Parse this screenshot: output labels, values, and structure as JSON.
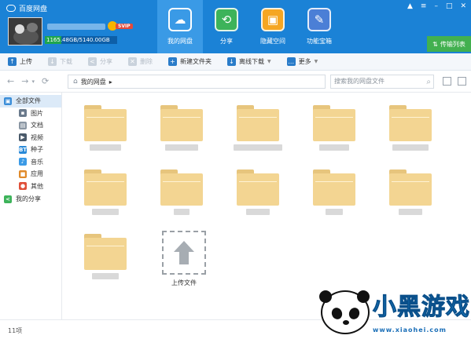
{
  "app": {
    "title": "百度网盘"
  },
  "user": {
    "badge": "SVIP",
    "quota": "1165.48GB/5140.00GB",
    "quota_fraction": 0.227
  },
  "main_tabs": [
    {
      "label": "我的网盘",
      "icon": "cloud-icon",
      "color": "#3a9ae6",
      "active": true
    },
    {
      "label": "分享",
      "icon": "share-icon",
      "color": "#3db35a",
      "active": false
    },
    {
      "label": "隐藏空间",
      "icon": "lock-icon",
      "color": "#f5a623",
      "active": false
    },
    {
      "label": "功能宝箱",
      "icon": "tools-icon",
      "color": "#4b7fd6",
      "active": false
    }
  ],
  "window_controls": [
    "▲",
    "≡",
    "–",
    "□",
    "✕"
  ],
  "transfer_button": {
    "label": "传输列表",
    "icon": "transfer-icon"
  },
  "toolbar": [
    {
      "label": "上传",
      "icon": "upload-icon",
      "enabled": true,
      "caret": false
    },
    {
      "label": "下载",
      "icon": "download-icon",
      "enabled": false,
      "caret": false
    },
    {
      "label": "分享",
      "icon": "share-icon",
      "enabled": false,
      "caret": false
    },
    {
      "label": "删除",
      "icon": "delete-icon",
      "enabled": false,
      "caret": false
    },
    {
      "label": "新建文件夹",
      "icon": "new-folder-icon",
      "enabled": true,
      "caret": false
    },
    {
      "label": "离线下载",
      "icon": "offline-download-icon",
      "enabled": true,
      "caret": true
    },
    {
      "label": "更多",
      "icon": "more-icon",
      "enabled": true,
      "caret": true
    }
  ],
  "navigation": {
    "breadcrumb": "我的网盘",
    "breadcrumb_arrow": "▸",
    "search_placeholder": "搜索我的网盘文件"
  },
  "sidebar": [
    {
      "label": "全部文件",
      "icon": "all-files-icon",
      "glyph": "▣",
      "color": "#3a8dd8",
      "top": true,
      "active": true
    },
    {
      "label": "图片",
      "icon": "image-icon",
      "glyph": "▪",
      "color": "#6a7a8c",
      "top": false,
      "active": false
    },
    {
      "label": "文档",
      "icon": "document-icon",
      "glyph": "▤",
      "color": "#8a96a3",
      "top": false,
      "active": false
    },
    {
      "label": "视频",
      "icon": "video-icon",
      "glyph": "▶",
      "color": "#4a5a6a",
      "top": false,
      "active": false
    },
    {
      "label": "种子",
      "icon": "bt-icon",
      "glyph": "BT",
      "color": "#2a8ad8",
      "top": false,
      "active": false
    },
    {
      "label": "音乐",
      "icon": "music-icon",
      "glyph": "♪",
      "color": "#3a9ae6",
      "top": false,
      "active": false
    },
    {
      "label": "应用",
      "icon": "app-icon",
      "glyph": "■",
      "color": "#e08a2a",
      "top": false,
      "active": false
    },
    {
      "label": "其他",
      "icon": "other-icon",
      "glyph": "●",
      "color": "#e0503a",
      "top": false,
      "active": false
    },
    {
      "label": "我的分享",
      "icon": "my-share-icon",
      "glyph": "<",
      "color": "#3db35a",
      "top": true,
      "active": false
    }
  ],
  "upload_tile": {
    "label": "上传文件"
  },
  "status": {
    "item_count": "11项"
  },
  "watermark": {
    "title": "小黑游戏",
    "url": "www.xiaohei.com"
  }
}
